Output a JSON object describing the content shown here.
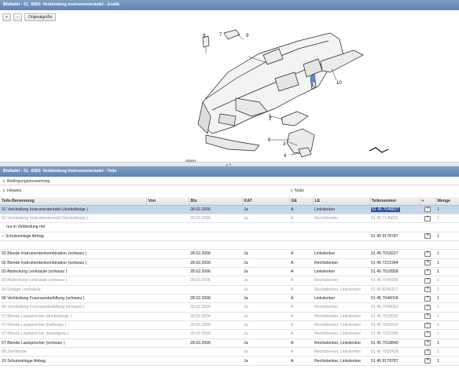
{
  "header": {
    "graphic_title": "Bildtafel - 51_4583: Verkleidung Instrumententafel - Grafik",
    "parts_title": "Bildtafel - 51_4583: Verkleidung Instrumententafel - Teile"
  },
  "toolbar": {
    "zoom_in": "+",
    "zoom_out": "-",
    "original_size": "Originalgröße"
  },
  "diagram": {
    "callouts": [
      "1",
      "2",
      "3",
      "4",
      "5",
      "6",
      "7",
      "8",
      "9",
      "10"
    ],
    "drawing_number": "0900"
  },
  "sections": {
    "conditions": "Bedingungsauswertung",
    "hints": "Hinweis",
    "notes": "Notiz"
  },
  "table": {
    "headers": [
      "Teile-Benennung",
      "Von",
      "Bis",
      "KAT",
      "GE",
      "LE",
      "Teilenummer",
      "+",
      "Menge"
    ],
    "rows": [
      {
        "name": "01 Verkleidung Instrumententafel (dunkelbeige )",
        "von": "",
        "bis": "28.02.2006",
        "kat": "Ja",
        "ge": "A",
        "le": "Linkslenker",
        "partno": "51 45 7048827",
        "menge": "1",
        "state": "sel"
      },
      {
        "name": "01 Verkleidung Instrumententafel (dunkelbeige )",
        "von": "",
        "bis": "28.02.2006",
        "kat": "Ja",
        "ge": "A",
        "le": "Rechtslenker",
        "partno": "51 45 7145631",
        "menge": "1",
        "state": "dim"
      },
      {
        "name": "nur in Verbindung mit",
        "von": "",
        "bis": "",
        "kat": "",
        "ge": "",
        "le": "",
        "partno": "",
        "menge": "",
        "state": "sub"
      },
      {
        "name": "-- Schutzeinlage Airbag",
        "von": "",
        "bis": "",
        "kat": "",
        "ge": "",
        "le": "",
        "partno": "51 45 9178787",
        "menge": "1",
        "state": "sub"
      },
      {
        "name": "",
        "von": "",
        "bis": "",
        "kat": "",
        "ge": "",
        "le": "",
        "partno": "",
        "menge": "",
        "state": "blank"
      },
      {
        "name": "02 Blende Instrumentenkombination (schwarz )",
        "von": "",
        "bis": "28.02.2006",
        "kat": "Ja",
        "ge": "A",
        "le": "Linkslenker",
        "partno": "51 45 7018227",
        "menge": "1",
        "state": ""
      },
      {
        "name": "02 Blende Instrumentenkombination (schwarz )",
        "von": "",
        "bis": "28.02.2006",
        "kat": "Ja",
        "ge": "A",
        "le": "Rechtslenker",
        "partno": "51 45 7221994",
        "menge": "1",
        "state": ""
      },
      {
        "name": "03 Abdeckung Lenksäule (schwarz )",
        "von": "",
        "bis": "28.02.2006",
        "kat": "Ja",
        "ge": "A",
        "le": "Linkslenker",
        "partno": "51 45 7018958",
        "menge": "1",
        "state": ""
      },
      {
        "name": "03 Abdeckung Lenksäule (schwarz )",
        "von": "",
        "bis": "28.02.2006",
        "kat": "Ja",
        "ge": "A",
        "le": "Rechtslenker",
        "partno": "51 45 7045555",
        "menge": "1",
        "state": "dim"
      },
      {
        "name": "04 Einlage Lenksäule",
        "von": "",
        "bis": "",
        "kat": "Ja",
        "ge": "A",
        "le": "Rechtslenker, Linkslenker",
        "partno": "51 45 8249117",
        "menge": "1",
        "state": "dim"
      },
      {
        "name": "06 Verkleidung Fussraumbelüftung (schwarz )",
        "von": "",
        "bis": "28.02.2006",
        "kat": "Ja",
        "ge": "A",
        "le": "Linkslenker",
        "partno": "51 45 7046018",
        "menge": "1",
        "state": ""
      },
      {
        "name": "06 Verkleidung Fussraumbelüftung (schwarz )",
        "von": "",
        "bis": "28.02.2006",
        "kat": "Ja",
        "ge": "A",
        "le": "Rechtslenker",
        "partno": "51 45 7046052",
        "menge": "1",
        "state": "dim"
      },
      {
        "name": "07 Blende Lautsprecher (dunkelbeige )",
        "von": "",
        "bis": "28.02.2006",
        "kat": "Ja",
        "ge": "A",
        "le": "Rechtslenker, Linkslenker",
        "partno": "51 45 7018592",
        "menge": "1",
        "state": "dim"
      },
      {
        "name": "07 Blende Lautsprecher (hellbeige )",
        "von": "",
        "bis": "28.02.2006",
        "kat": "Ja",
        "ge": "A",
        "le": "Rechtslenker, Linkslenker",
        "partno": "51 45 7065514",
        "menge": "1",
        "state": "dim"
      },
      {
        "name": "07 Blende Lautsprecher (basaltgrau )",
        "von": "",
        "bis": "28.02.2006",
        "kat": "Ja",
        "ge": "A",
        "le": "Rechtslenker, Linkslenker",
        "partno": "51 45 7221996",
        "menge": "1",
        "state": "dim"
      },
      {
        "name": "07 Blende Lautsprecher (schwarz )",
        "von": "",
        "bis": "28.02.2006",
        "kat": "Ja",
        "ge": "A",
        "le": "Rechtslenker, Linkslenker",
        "partno": "51 45 7018840",
        "menge": "1",
        "state": ""
      },
      {
        "name": "08 Zierblende",
        "von": "",
        "bis": "",
        "kat": "Ja",
        "ge": "A",
        "le": "Rechtslenker, Linkslenker",
        "partno": "51 45 7002428",
        "menge": "2",
        "state": "dim"
      },
      {
        "name": "10 Schutzeinlage Airbag",
        "von": "",
        "bis": "",
        "kat": "Ja",
        "ge": "A",
        "le": "Rechtslenker, Linkslenker",
        "partno": "51 45 9178787",
        "menge": "1",
        "state": ""
      }
    ]
  }
}
